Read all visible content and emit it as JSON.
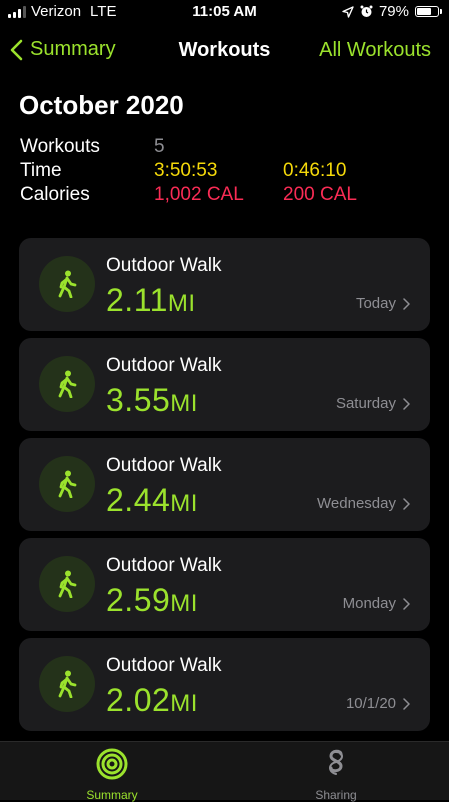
{
  "status_bar": {
    "carrier": "Verizon",
    "network": "LTE",
    "time": "11:05 AM",
    "battery_percent": "79%",
    "battery_level": 0.79
  },
  "nav": {
    "back_label": "Summary",
    "title": "Workouts",
    "right_label": "All Workouts"
  },
  "month_title": "October 2020",
  "summary": {
    "workouts_label": "Workouts",
    "workouts_value": "5",
    "time_label": "Time",
    "time_total": "3:50:53",
    "time_avg": "0:46:10",
    "calories_label": "Calories",
    "calories_total": "1,002 CAL",
    "calories_avg": "200 CAL"
  },
  "workouts": [
    {
      "type": "Outdoor Walk",
      "distance": "2.11",
      "unit": "MI",
      "date": "Today"
    },
    {
      "type": "Outdoor Walk",
      "distance": "3.55",
      "unit": "MI",
      "date": "Saturday"
    },
    {
      "type": "Outdoor Walk",
      "distance": "2.44",
      "unit": "MI",
      "date": "Wednesday"
    },
    {
      "type": "Outdoor Walk",
      "distance": "2.59",
      "unit": "MI",
      "date": "Monday"
    },
    {
      "type": "Outdoor Walk",
      "distance": "2.02",
      "unit": "MI",
      "date": "10/1/20"
    }
  ],
  "tab_bar": {
    "summary_label": "Summary",
    "sharing_label": "Sharing"
  },
  "colors": {
    "accent_green": "#9be22d",
    "time_yellow": "#f5d90a",
    "calorie_red": "#fa2c55",
    "secondary_gray": "#8e8e93"
  },
  "icons": {
    "walk": "figure-walk-icon",
    "back": "chevron-left-icon",
    "disclosure": "chevron-right-icon",
    "summary_tab": "activity-rings-icon",
    "sharing_tab": "sharing-icon"
  }
}
